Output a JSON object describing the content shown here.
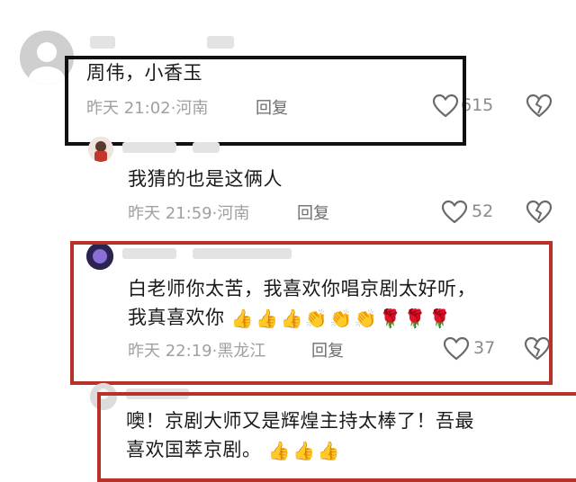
{
  "comments": [
    {
      "text": "周伟，小香玉",
      "time": "昨天 21:02",
      "location": "河南",
      "reply_label": "回复",
      "likes": "615"
    },
    {
      "text": "我猜的也是这俩人",
      "time": "昨天 21:59",
      "location": "河南",
      "reply_label": "回复",
      "likes": "52"
    },
    {
      "text_line1": "白老师你太苦，我喜欢你唱京剧太好听，",
      "text_line2": "我真喜欢你",
      "emojis": [
        "👍",
        "👍",
        "👍",
        "👏",
        "👏",
        "👏",
        "🌹",
        "🌹",
        "🌹"
      ],
      "time": "昨天 22:19",
      "location": "黑龙江",
      "reply_label": "回复",
      "likes": "37"
    },
    {
      "text_line1": "噢！京剧大师又是辉煌主持太棒了！吾最",
      "text_line2": "喜欢国萃京剧。",
      "emojis": [
        "👍",
        "👍",
        "👍"
      ]
    }
  ],
  "separator": "·",
  "colors": {
    "highlight_black": "#111111",
    "highlight_red": "#b8322a"
  },
  "icons": {
    "like": "heart-outline-icon",
    "dislike": "broken-heart-icon"
  }
}
